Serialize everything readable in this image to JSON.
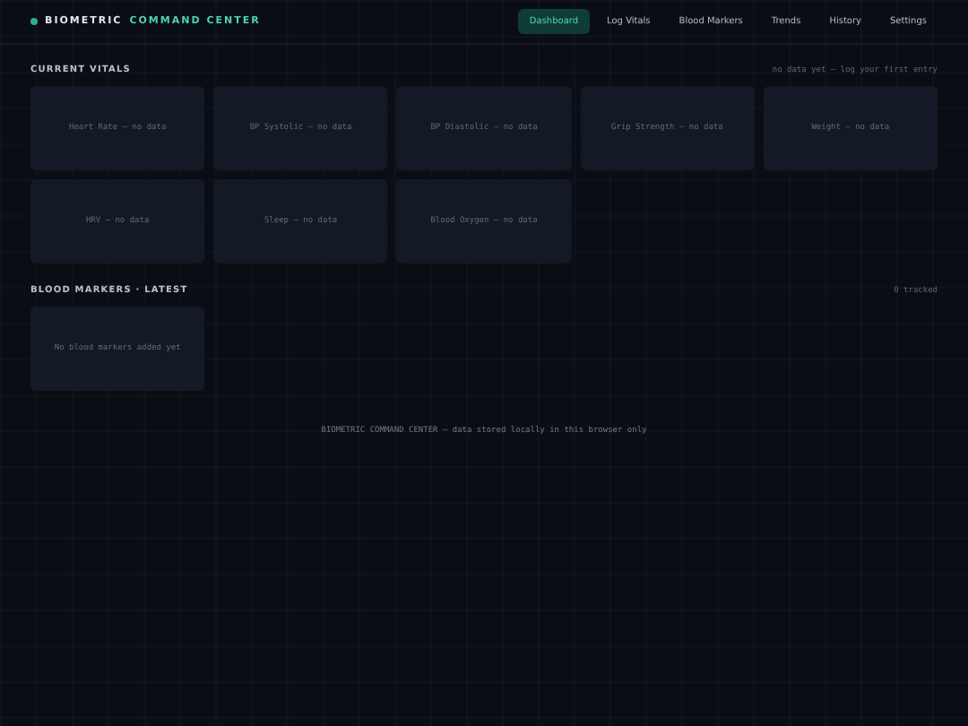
{
  "header": {
    "brand_primary": "BIOMETRIC",
    "brand_accent": "COMMAND CENTER",
    "nav": [
      {
        "label": "Dashboard",
        "selected": true
      },
      {
        "label": "Log Vitals",
        "selected": false
      },
      {
        "label": "Blood Markers",
        "selected": false
      },
      {
        "label": "Trends",
        "selected": false
      },
      {
        "label": "History",
        "selected": false
      },
      {
        "label": "Settings",
        "selected": false
      }
    ]
  },
  "vitals": {
    "title": "CURRENT VITALS",
    "note": "no data yet — log your first entry",
    "cards": [
      "Heart Rate — no data",
      "BP Systolic — no data",
      "BP Diastolic — no data",
      "Grip Strength — no data",
      "Weight — no data",
      "HRV — no data",
      "Sleep — no data",
      "Blood Oxygen — no data"
    ]
  },
  "blood_markers": {
    "title": "BLOOD MARKERS · LATEST",
    "note": "0 tracked",
    "cards": [
      "No blood markers added yet"
    ]
  },
  "footer": "BIOMETRIC COMMAND CENTER — data stored locally in this browser only"
}
